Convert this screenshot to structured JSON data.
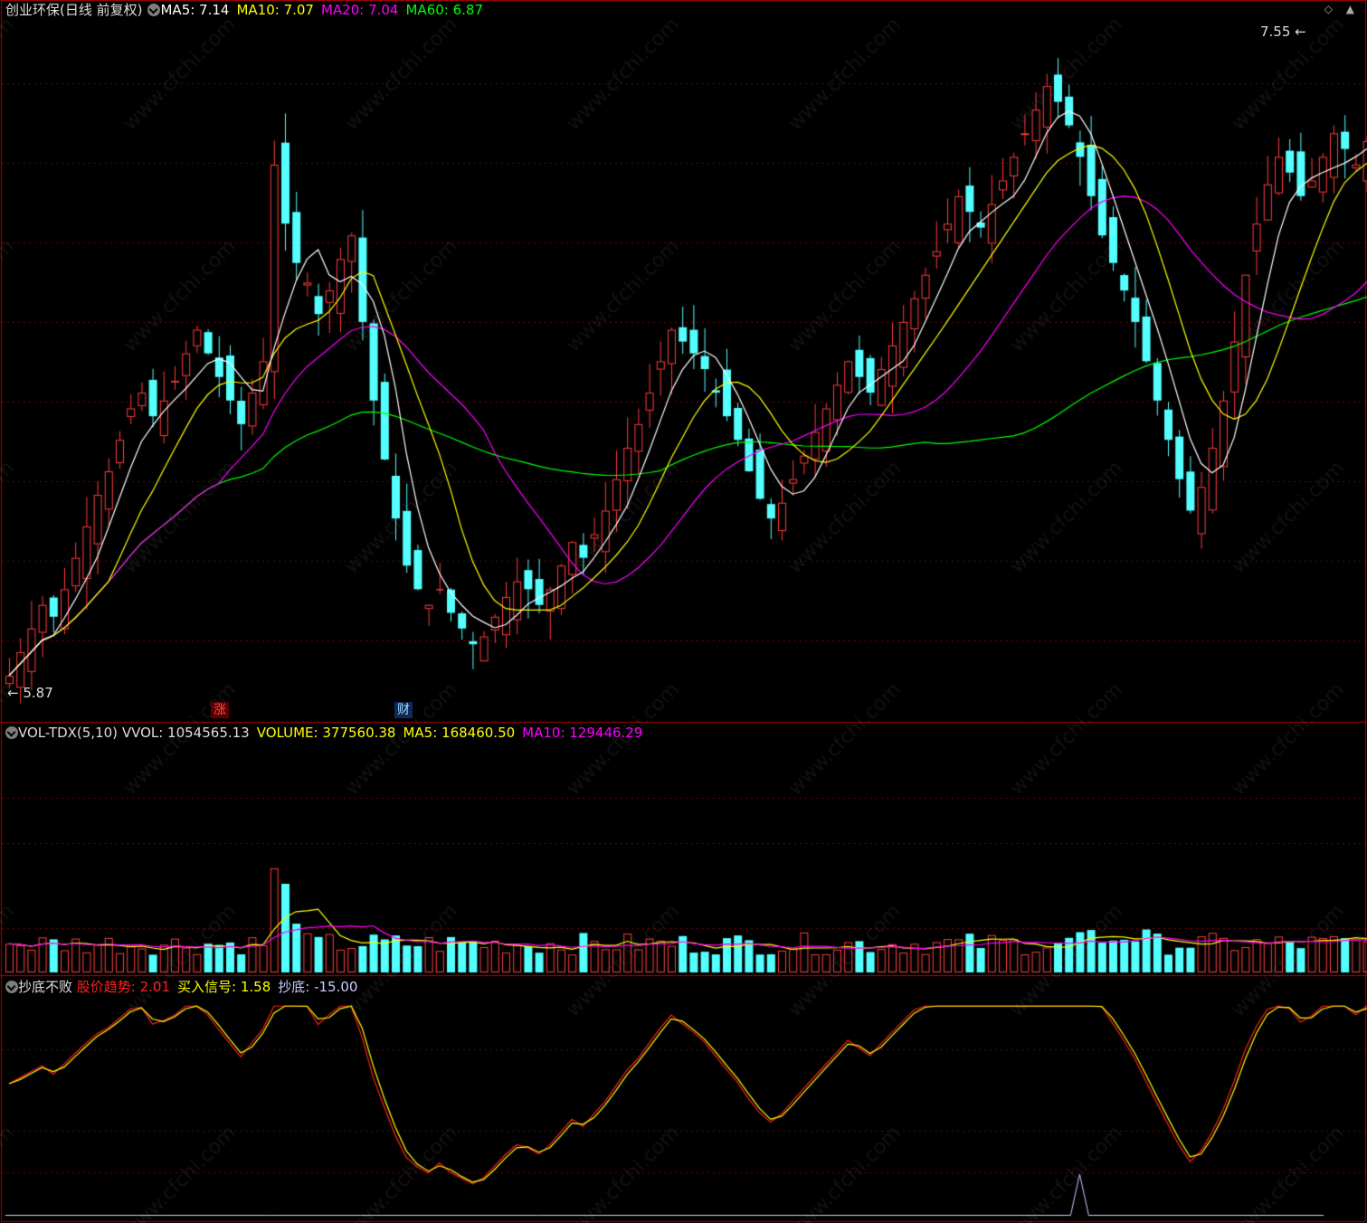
{
  "main": {
    "title": "创业环保(日线 前复权)",
    "ma": [
      {
        "label": "MA5: 7.14",
        "color": "#ffffff"
      },
      {
        "label": "MA10: 7.07",
        "color": "#ffff00"
      },
      {
        "label": "MA20: 7.04",
        "color": "#ff00ff"
      },
      {
        "label": "MA60: 6.87",
        "color": "#00ff00"
      }
    ],
    "high_label": "7.55",
    "low_label": "5.87",
    "tags": [
      {
        "text": "涨",
        "color": "#ff4d4d",
        "bg": "#5a0000"
      },
      {
        "text": "财",
        "color": "#9fd7ff",
        "bg": "#0d2a55"
      }
    ]
  },
  "vol": {
    "name": "VOL-TDX(5,10)",
    "items": [
      {
        "label": "VVOL: 1054565.13",
        "color": "#dddddd"
      },
      {
        "label": "VOLUME: 377560.38",
        "color": "#ffff00"
      },
      {
        "label": "MA5: 168460.50",
        "color": "#ffff00"
      },
      {
        "label": "MA10: 129446.29",
        "color": "#ff00ff"
      }
    ]
  },
  "ind": {
    "name": "抄底不败",
    "items": [
      {
        "label": "股价趋势: 2.01",
        "color": "#ff2020"
      },
      {
        "label": "买入信号: 1.58",
        "color": "#ffff00"
      },
      {
        "label": "抄底: -15.00",
        "color": "#ccccff"
      }
    ]
  },
  "watermark": "www.cfchi.com",
  "colors": {
    "up": "#ff3c3c",
    "down": "#54ffff",
    "frame": "#b00000",
    "grid": "#7a0000"
  },
  "chart_data": {
    "type": "candlestick",
    "price_range": [
      5.87,
      7.55
    ],
    "candles_close": [
      5.9,
      5.96,
      6.02,
      6.08,
      6.05,
      6.12,
      6.2,
      6.28,
      6.36,
      6.42,
      6.5,
      6.58,
      6.62,
      6.56,
      6.6,
      6.65,
      6.72,
      6.78,
      6.72,
      6.66,
      6.6,
      6.54,
      6.62,
      6.7,
      7.2,
      7.05,
      6.95,
      6.9,
      6.82,
      6.88,
      6.96,
      7.02,
      6.8,
      6.6,
      6.45,
      6.3,
      6.18,
      6.12,
      6.08,
      6.12,
      6.06,
      6.02,
      5.98,
      6.0,
      6.05,
      6.1,
      6.14,
      6.12,
      6.08,
      6.12,
      6.18,
      6.24,
      6.2,
      6.26,
      6.32,
      6.4,
      6.48,
      6.54,
      6.62,
      6.7,
      6.78,
      6.75,
      6.72,
      6.68,
      6.62,
      6.56,
      6.5,
      6.42,
      6.35,
      6.3,
      6.34,
      6.4,
      6.46,
      6.52,
      6.58,
      6.64,
      6.7,
      6.66,
      6.62,
      6.68,
      6.74,
      6.8,
      6.86,
      6.92,
      6.98,
      7.05,
      7.12,
      7.08,
      7.04,
      7.1,
      7.16,
      7.22,
      7.28,
      7.34,
      7.4,
      7.36,
      7.3,
      7.22,
      7.12,
      7.02,
      6.95,
      6.88,
      6.8,
      6.7,
      6.6,
      6.5,
      6.4,
      6.32,
      6.38,
      6.48,
      6.6,
      6.75,
      6.92,
      7.05,
      7.15,
      7.22,
      7.18,
      7.12,
      7.16,
      7.22,
      7.28,
      7.24,
      7.2,
      7.26,
      7.32,
      7.38,
      7.3,
      7.2,
      7.26,
      7.3,
      7.14
    ],
    "volume_overlay": [
      "VOLUME",
      "MA5",
      "MA10"
    ],
    "indicator_series": [
      "股价趋势",
      "买入信号",
      "抄底"
    ]
  }
}
